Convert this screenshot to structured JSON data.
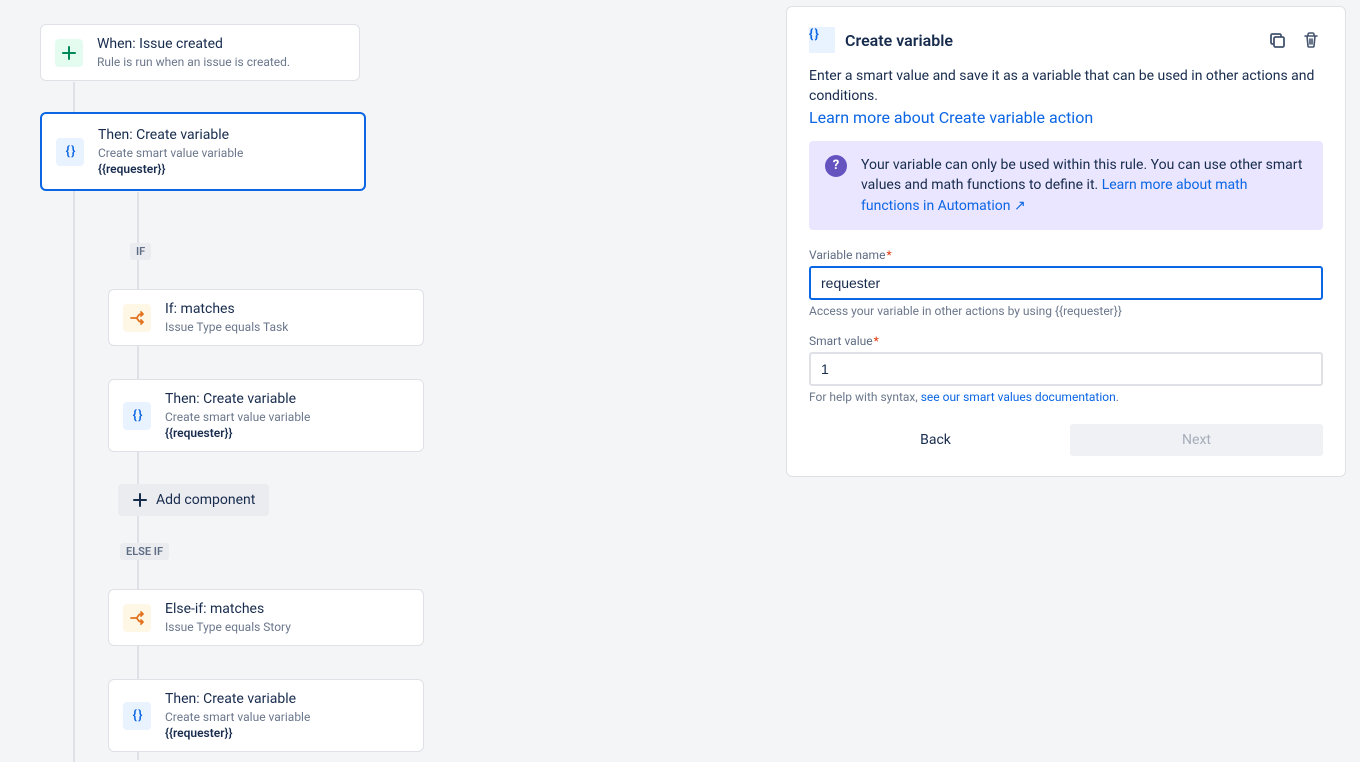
{
  "canvas": {
    "trigger": {
      "title": "When: Issue created",
      "sub": "Rule is run when an issue is created."
    },
    "selected": {
      "title": "Then: Create variable",
      "sub": "Create smart value variable",
      "extra": "{{requester}}"
    },
    "badge_if": "IF",
    "if_node": {
      "title": "If: matches",
      "sub": "Issue Type equals Task"
    },
    "then1": {
      "title": "Then: Create variable",
      "sub": "Create smart value variable",
      "extra": "{{requester}}"
    },
    "add_component": "Add component",
    "badge_elseif": "ELSE IF",
    "elseif_node": {
      "title": "Else-if: matches",
      "sub": "Issue Type equals Story"
    },
    "then2": {
      "title": "Then: Create variable",
      "sub": "Create smart value variable",
      "extra": "{{requester}}"
    }
  },
  "panel": {
    "title": "Create variable",
    "desc": "Enter a smart value and save it as a variable that can be used in other actions and conditions.",
    "learn_link": "Learn more about Create variable action",
    "info_text1": "Your variable can only be used within this rule. You can use other smart values and math functions to define it. ",
    "info_link": "Learn more about math functions in Automation",
    "arrow": "↗",
    "var_label": "Variable name",
    "var_value": "requester",
    "var_hint": "Access your variable in other actions by using {{requester}}",
    "smart_label": "Smart value",
    "smart_value": "1",
    "smart_hint_prefix": "For help with syntax, ",
    "smart_hint_link": "see our smart values documentation",
    "smart_hint_suffix": ".",
    "back": "Back",
    "next": "Next"
  }
}
